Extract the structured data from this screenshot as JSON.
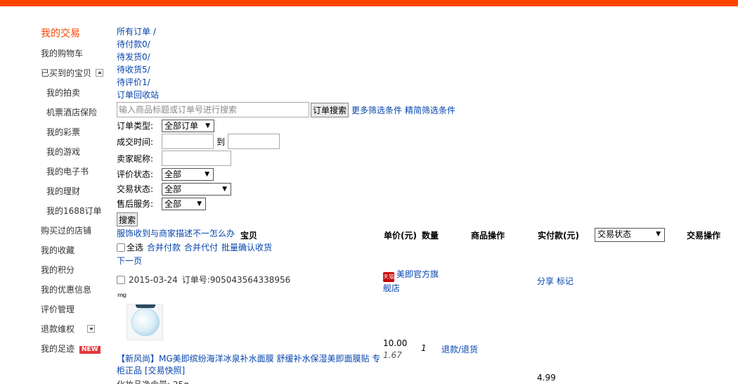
{
  "sidebar": {
    "title": "我的交易",
    "items": [
      {
        "label": "我的购物车"
      },
      {
        "label": "已买到的宝贝"
      },
      {
        "label": "我的拍卖"
      },
      {
        "label": "机票酒店保险"
      },
      {
        "label": "我的彩票"
      },
      {
        "label": "我的游戏"
      },
      {
        "label": "我的电子书"
      },
      {
        "label": "我的理财"
      },
      {
        "label": "我的1688订单"
      },
      {
        "label": "购买过的店铺"
      },
      {
        "label": "我的收藏"
      },
      {
        "label": "我的积分"
      },
      {
        "label": "我的优惠信息"
      },
      {
        "label": "评价管理"
      },
      {
        "label": "退款维权"
      },
      {
        "label": "我的足迹"
      }
    ],
    "new_badge": "NEW"
  },
  "tabs": [
    {
      "label": "所有订单",
      "sep": " /"
    },
    {
      "label": "待付款0/",
      "sep": ""
    },
    {
      "label": "待发货0/",
      "sep": ""
    },
    {
      "label": "待收货5/",
      "sep": ""
    },
    {
      "label": "待评价1/",
      "sep": ""
    },
    {
      "label": "订单回收站",
      "sep": ""
    }
  ],
  "search": {
    "placeholder": "输入商品标题或订单号进行搜索",
    "button": "订单搜索",
    "more_filters": "更多筛选条件",
    "simple_filters": "精简筛选条件"
  },
  "filters": {
    "order_type_label": "订单类型:",
    "order_type_value": "全部订单",
    "time_label": "成交时间:",
    "to_label": "到",
    "seller_label": "卖家昵称:",
    "rate_label": "评价状态:",
    "rate_value": "全部",
    "trade_label": "交易状态:",
    "trade_value": "全部",
    "after_label": "售后服务:",
    "after_value": "全部",
    "search_button": "搜索"
  },
  "promo_link": "服饰收到与商家描述不一怎么办",
  "table_header": {
    "item": "宝贝",
    "price": "单价(元)",
    "qty": "数量",
    "ops": "商品操作",
    "paid": "实付款(元)",
    "status_select": "交易状态",
    "trade_ops": "交易操作"
  },
  "bulk": {
    "select_all": "全选",
    "merge_pay": "合并付款",
    "merge_proxy": "合并代付",
    "batch_confirm": "批量确认收货",
    "next_page": "下一页"
  },
  "order": {
    "date": "2015-03-24",
    "order_no_label": "订单号:",
    "order_no": "905043564338956",
    "shop_icon": "天猫",
    "shop_name": "美即官方旗舰店",
    "share": "分享",
    "mark": "标记",
    "brand_logo": "mg",
    "price": "10.00",
    "orig_price": "1.67",
    "qty": "1",
    "refund": "退款/退货",
    "title_tag": "【新风尚】",
    "title": "MG美即缤纷海洋冰泉补水面膜 舒缓补水保湿美即面膜贴 专柜正品",
    "snapshot": "[交易快照]",
    "sub": "化妆品净含量: 25g",
    "paid": "4.99"
  }
}
